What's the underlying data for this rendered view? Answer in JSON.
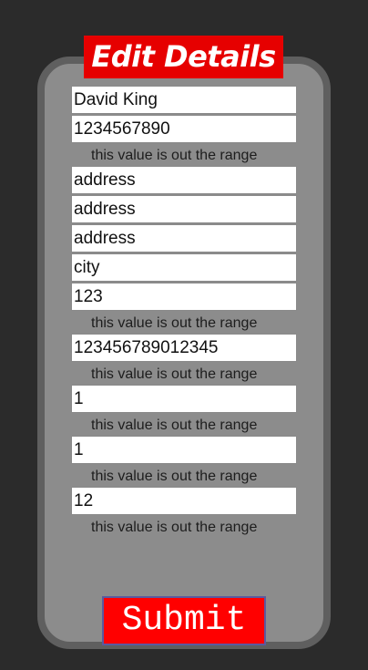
{
  "header": {
    "title": "Edit Details"
  },
  "form": {
    "fields": [
      {
        "name": "name",
        "value": "David King"
      },
      {
        "name": "phone",
        "value": "1234567890",
        "error": "this value is out the range"
      },
      {
        "name": "address1",
        "value": "address"
      },
      {
        "name": "address2",
        "value": "address"
      },
      {
        "name": "address3",
        "value": "address"
      },
      {
        "name": "city",
        "value": "city"
      },
      {
        "name": "code",
        "value": "123",
        "error": "this value is out the range"
      },
      {
        "name": "long-number",
        "value": "123456789012345",
        "error": "this value is out the range"
      },
      {
        "name": "number-a",
        "value": "1",
        "error": "this value is out the range"
      },
      {
        "name": "number-b",
        "value": "1",
        "error": "this value is out the range"
      },
      {
        "name": "number-c",
        "value": "12",
        "error": "this value is out the range"
      }
    ],
    "submit_label": "Submit"
  },
  "colors": {
    "background": "#2b2b2b",
    "card": "#8c8c8c",
    "card_border": "#5f5f5f",
    "accent": "#e60000"
  }
}
